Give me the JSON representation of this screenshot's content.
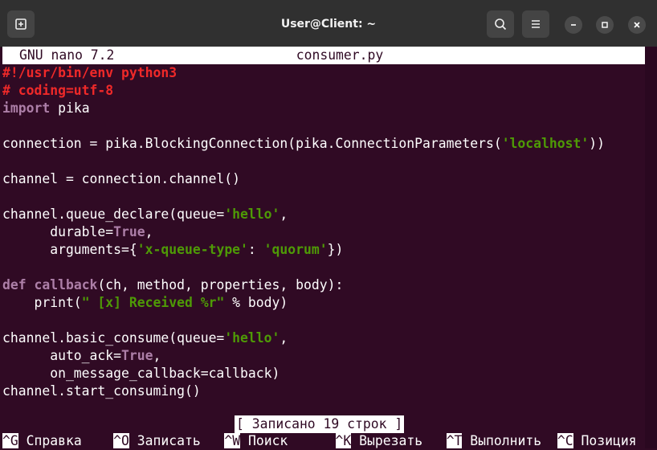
{
  "window": {
    "title": "User@Client: ~"
  },
  "nano": {
    "version": "GNU nano 7.2",
    "filename": "consumer.py",
    "status": "[ Записано 19 строк ]",
    "shortcuts": [
      {
        "key": "^G",
        "label": "Справка"
      },
      {
        "key": "^O",
        "label": "Записать"
      },
      {
        "key": "^W",
        "label": "Поиск"
      },
      {
        "key": "^K",
        "label": "Вырезать"
      },
      {
        "key": "^T",
        "label": "Выполнить"
      },
      {
        "key": "^C",
        "label": "Позиция"
      }
    ]
  },
  "code": [
    [
      {
        "t": "#!/usr/bin/env python3",
        "c": "c"
      }
    ],
    [
      {
        "t": "# coding=utf-8",
        "c": "c"
      }
    ],
    [
      {
        "t": "import",
        "c": "k"
      },
      {
        "t": " pika"
      }
    ],
    [],
    [
      {
        "t": "connection = pika.BlockingConnection(pika.ConnectionParameters("
      },
      {
        "t": "'localhost'",
        "c": "s"
      },
      {
        "t": "))"
      }
    ],
    [],
    [
      {
        "t": "channel = connection.channel()"
      }
    ],
    [],
    [
      {
        "t": "channel.queue_declare(queue="
      },
      {
        "t": "'hello'",
        "c": "s"
      },
      {
        "t": ","
      }
    ],
    [
      {
        "t": "      durable="
      },
      {
        "t": "True",
        "c": "k"
      },
      {
        "t": ","
      }
    ],
    [
      {
        "t": "      arguments={"
      },
      {
        "t": "'x-queue-type'",
        "c": "s"
      },
      {
        "t": ": "
      },
      {
        "t": "'quorum'",
        "c": "s"
      },
      {
        "t": "})"
      }
    ],
    [],
    [
      {
        "t": "def",
        "c": "k"
      },
      {
        "t": " "
      },
      {
        "t": "callback",
        "c": "k"
      },
      {
        "t": "(ch, method, properties, body):"
      }
    ],
    [
      {
        "t": "    print("
      },
      {
        "t": "\" [x] Received %r\"",
        "c": "s"
      },
      {
        "t": " % body)"
      }
    ],
    [],
    [
      {
        "t": "channel.basic_consume(queue="
      },
      {
        "t": "'hello'",
        "c": "s"
      },
      {
        "t": ","
      }
    ],
    [
      {
        "t": "      auto_ack="
      },
      {
        "t": "True",
        "c": "k"
      },
      {
        "t": ","
      }
    ],
    [
      {
        "t": "      on_message_callback=callback)"
      }
    ],
    [
      {
        "t": "channel.start_consuming()"
      }
    ]
  ]
}
